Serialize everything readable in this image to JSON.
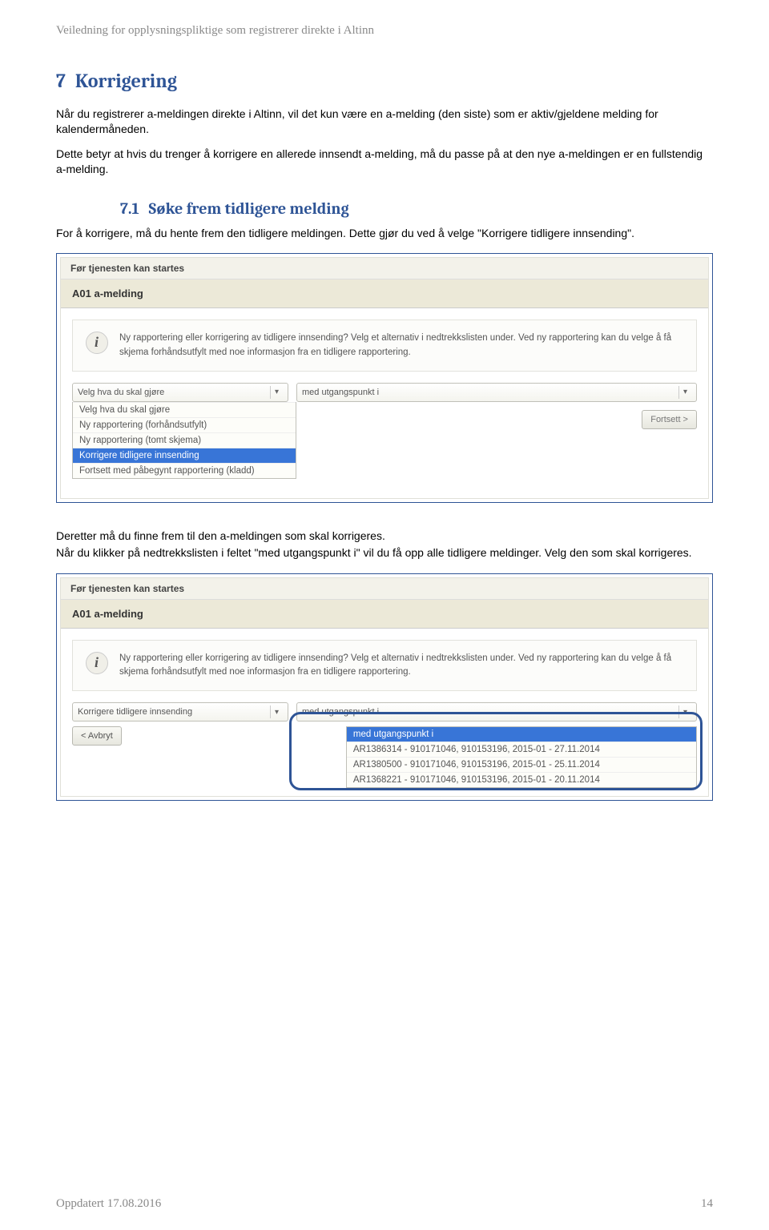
{
  "header": "Veiledning for opplysningspliktige som registrerer direkte i Altinn",
  "section": {
    "num": "7",
    "title": "Korrigering"
  },
  "para1": "Når du registrerer a-meldingen direkte i Altinn, vil det kun være en a-melding (den siste) som er aktiv/gjeldene melding for kalendermåneden.",
  "para2": "Dette betyr at hvis du trenger å korrigere en allerede innsendt a-melding, må du passe på at den nye a-meldingen er en fullstendig a-melding.",
  "sub": {
    "num": "7.1",
    "title": "Søke frem tidligere melding"
  },
  "para3": "For å korrigere, må du hente frem den tidligere meldingen. Dette gjør du ved å velge \"Korrigere tidligere innsending\".",
  "para4": "Deretter må du finne frem til den a-meldingen som skal korrigeres.",
  "para5": "Når du klikker på nedtrekkslisten i feltet \"med utgangspunkt i\" vil du få opp alle tidligere meldinger. Velg den som skal korrigeres.",
  "panel": {
    "pretitle": "Før tjenesten kan startes",
    "title": "A01 a-melding",
    "info": "Ny rapportering eller korrigering av tidligere innsending? Velg et alternativ i nedtrekkslisten under. Ved ny rapportering kan du velge å få skjema forhåndsutfylt med noe informasjon fra en tidligere rapportering.",
    "select1_label": "Velg hva du skal gjøre",
    "select2_label": "med utgangspunkt i",
    "fortsett": "Fortsett >",
    "dropdown1": [
      "Velg hva du skal gjøre",
      "Ny rapportering (forhåndsutfylt)",
      "Ny rapportering (tomt skjema)",
      "Korrigere tidligere innsending",
      "Fortsett med påbegynt rapportering (kladd)"
    ]
  },
  "panel2": {
    "select1_value": "Korrigere tidligere innsending",
    "select2_value": "med utgangspunkt i",
    "avbryt": "<  Avbryt",
    "dropdown2": [
      "med utgangspunkt i",
      "AR1386314 - 910171046, 910153196, 2015-01 - 27.11.2014",
      "AR1380500 - 910171046, 910153196, 2015-01 - 25.11.2014",
      "AR1368221 - 910171046, 910153196, 2015-01 - 20.11.2014"
    ]
  },
  "footer_left": "Oppdatert  17.08.2016",
  "footer_right": "14"
}
